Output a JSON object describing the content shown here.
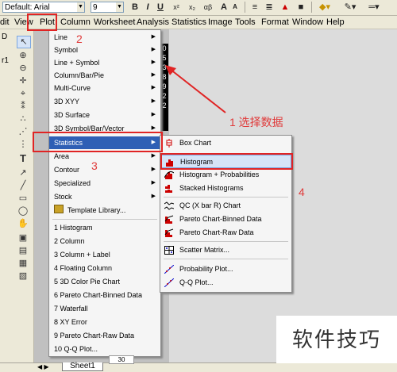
{
  "toolbar": {
    "font_label": "Default: Arial",
    "font_size": "9",
    "bold": "B",
    "italic": "I",
    "underline": "U",
    "superscript": "x²",
    "subscript": "x₂",
    "align": "αβ",
    "big": "A",
    "small": "A"
  },
  "menubar": {
    "items": [
      "dit",
      "View",
      "Plot",
      "Column",
      "Worksheet",
      "Analysis",
      "Statistics",
      "Image",
      "Tools",
      "Format",
      "Window",
      "Help"
    ]
  },
  "plot_menu": {
    "items": [
      {
        "label": "Line",
        "arrow": true
      },
      {
        "label": "Symbol",
        "arrow": true
      },
      {
        "label": "Line + Symbol",
        "arrow": true
      },
      {
        "label": "Column/Bar/Pie",
        "arrow": true
      },
      {
        "label": "Multi-Curve",
        "arrow": true
      },
      {
        "label": "3D XYY",
        "arrow": true
      },
      {
        "label": "3D Surface",
        "arrow": true
      },
      {
        "label": "3D Symbol/Bar/Vector",
        "arrow": true
      },
      {
        "label": "Statistics",
        "arrow": true
      },
      {
        "label": "Area",
        "arrow": true
      },
      {
        "label": "Contour",
        "arrow": true
      },
      {
        "label": "Specialized",
        "arrow": true
      },
      {
        "label": "Stock",
        "arrow": true
      },
      {
        "label": "Template Library...",
        "arrow": false
      },
      {
        "label": "1 Histogram",
        "arrow": false
      },
      {
        "label": "2 Column",
        "arrow": false
      },
      {
        "label": "3 Column + Label",
        "arrow": false
      },
      {
        "label": "4 Floating Column",
        "arrow": false
      },
      {
        "label": "5 3D Color Pie Chart",
        "arrow": false
      },
      {
        "label": "6 Pareto Chart-Binned Data",
        "arrow": false
      },
      {
        "label": "7 Waterfall",
        "arrow": false
      },
      {
        "label": "8 XY Error",
        "arrow": false
      },
      {
        "label": "9 Pareto Chart-Raw Data",
        "arrow": false
      },
      {
        "label": "10 Q-Q Plot...",
        "arrow": false
      }
    ]
  },
  "statistics_submenu": {
    "items": [
      {
        "label": "Box Chart",
        "icon": "box-chart-icon"
      },
      {
        "label": "Histogram",
        "icon": "histogram-icon"
      },
      {
        "label": "Histogram + Probabilities",
        "icon": "histogram-prob-icon"
      },
      {
        "label": "Stacked Histograms",
        "icon": "stacked-histograms-icon"
      },
      {
        "label": "QC (X bar R) Chart",
        "icon": "qc-chart-icon"
      },
      {
        "label": "Pareto Chart-Binned Data",
        "icon": "pareto-binned-icon"
      },
      {
        "label": "Pareto Chart-Raw Data",
        "icon": "pareto-raw-icon"
      },
      {
        "label": "Scatter Matrix...",
        "icon": "scatter-matrix-icon"
      },
      {
        "label": "Probability Plot...",
        "icon": "probability-plot-icon"
      },
      {
        "label": "Q-Q Plot...",
        "icon": "qq-plot-icon"
      }
    ]
  },
  "data_column": [
    "0",
    "5",
    "3",
    "8",
    "9",
    "2",
    "2"
  ],
  "annotations": {
    "n1": "1 选择数据",
    "n2": "2",
    "n3": "3",
    "n4": "4"
  },
  "left_panel": {
    "top": "D",
    "bottom": "r1"
  },
  "bottom": {
    "sheet_tab": "Sheet1",
    "nav": "◀ ▶",
    "cell_value": "30"
  },
  "watermark": "软件技巧",
  "colors": {
    "highlight": "#2f5fb5",
    "annotation_red": "#e02424"
  }
}
